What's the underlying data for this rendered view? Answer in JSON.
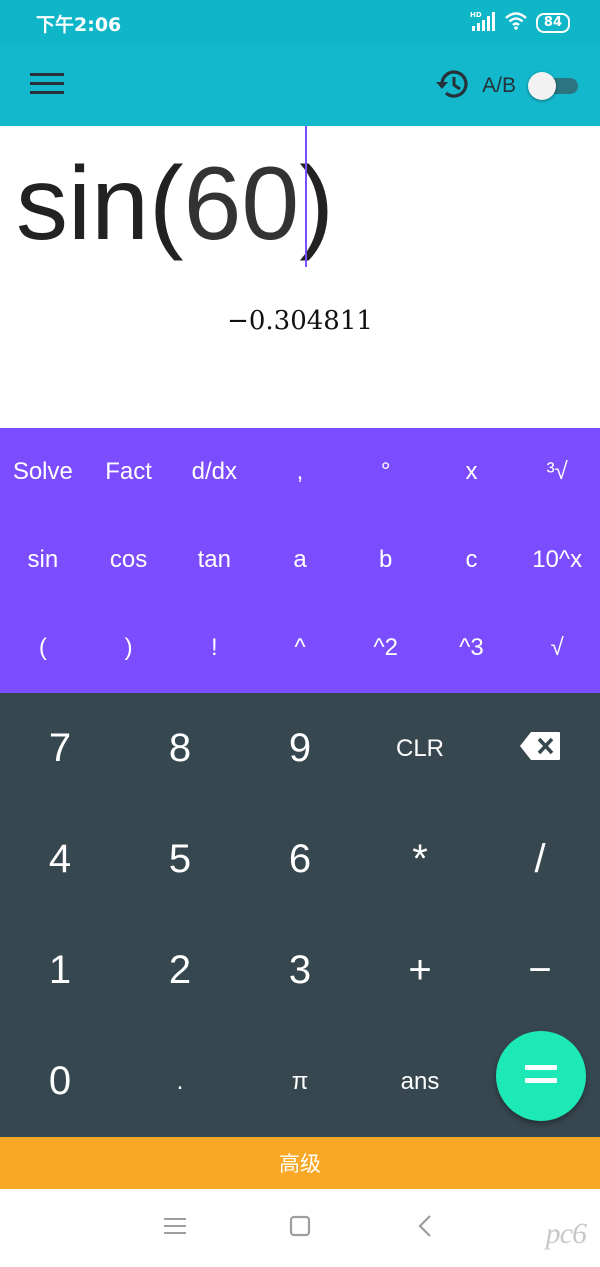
{
  "status": {
    "time": "下午2:06",
    "network": "HD",
    "battery": "84"
  },
  "appbar": {
    "ab_label": "A/B"
  },
  "display": {
    "expr_fn": "sin(",
    "expr_arg": "60",
    "expr_close": ")",
    "result": "−0.304811"
  },
  "advanced_keys": [
    [
      "Solve",
      "Fact",
      "d/dx",
      ",",
      "°",
      "x",
      "³√"
    ],
    [
      "sin",
      "cos",
      "tan",
      "a",
      "b",
      "c",
      "10^x"
    ],
    [
      "(",
      ")",
      "!",
      "^",
      "^2",
      "^3",
      "√"
    ]
  ],
  "keypad": [
    [
      "7",
      "8",
      "9",
      "CLR",
      ""
    ],
    [
      "4",
      "5",
      "6",
      "*",
      "/"
    ],
    [
      "1",
      "2",
      "3",
      "+",
      "−"
    ],
    [
      "0",
      ".",
      "π",
      "ans",
      ""
    ]
  ],
  "advanced_bar": {
    "label": "高级"
  },
  "watermark": {
    "text": "pc6"
  },
  "colors": {
    "accent": "#7c4dff",
    "appbar": "#13b8cc",
    "pad": "#37474f",
    "equals": "#1de9b6",
    "advanced": "#f9a825"
  }
}
